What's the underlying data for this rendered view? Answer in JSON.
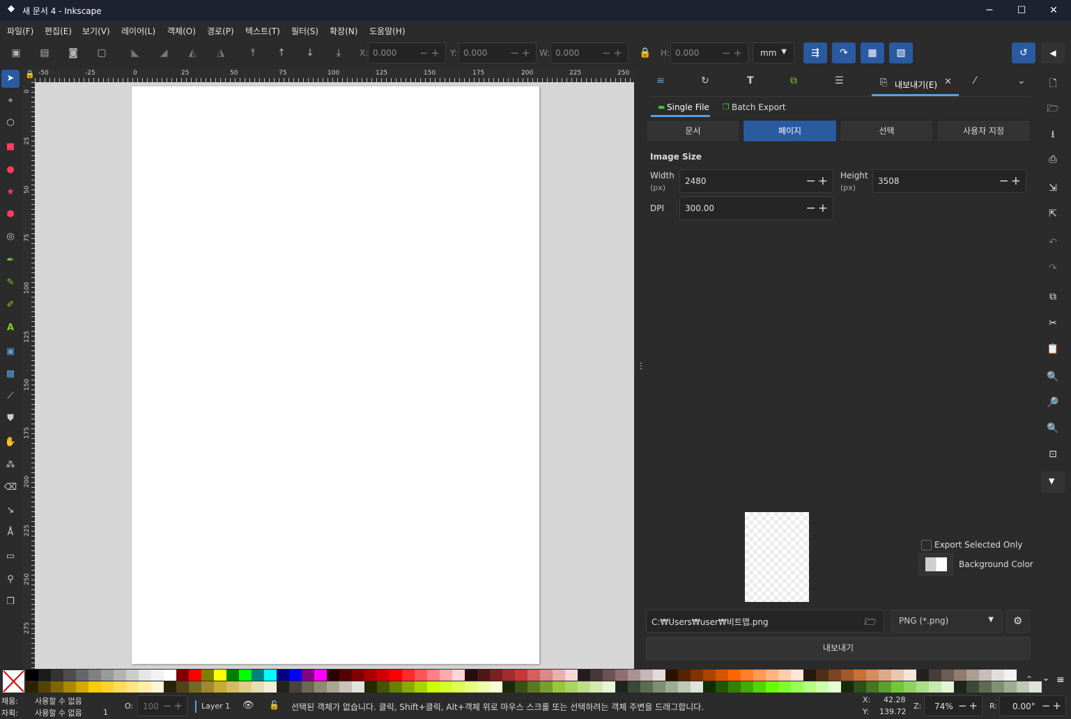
{
  "window": {
    "title": "새 문서 4 - Inkscape",
    "min": "─",
    "max": "☐",
    "close": "✕"
  },
  "menu": [
    "파일(F)",
    "편집(E)",
    "보기(V)",
    "레이어(L)",
    "객체(O)",
    "경로(P)",
    "텍스트(T)",
    "필터(S)",
    "확장(N)",
    "도움말(H)"
  ],
  "toolbar": {
    "x_label": "X:",
    "x_value": "0.000",
    "y_label": "Y:",
    "y_value": "0.000",
    "w_label": "W:",
    "w_value": "0.000",
    "h_label": "H:",
    "h_value": "0.000",
    "unit": "mm"
  },
  "ruler_top": [
    "-50",
    "-25",
    "0",
    "25",
    "50",
    "75",
    "100",
    "125",
    "150",
    "175",
    "200",
    "225",
    "250"
  ],
  "ruler_left": [
    "0",
    "25",
    "50",
    "75",
    "100",
    "125",
    "150",
    "175",
    "200",
    "225",
    "250",
    "275"
  ],
  "dock": {
    "tabs": {
      "export_label": "내보내기(E)"
    },
    "subtabs": {
      "single": "Single File",
      "batch": "Batch Export"
    },
    "areas": [
      "문서",
      "페이지",
      "선택",
      "사용자 지정"
    ],
    "active_area": "페이지",
    "image_size_label": "Image Size",
    "width_label": "Width",
    "width_unit": "(px)",
    "width_value": "2480",
    "height_label": "Height",
    "height_unit": "(px)",
    "height_value": "3508",
    "dpi_label": "DPI",
    "dpi_value": "300.00",
    "export_selected_only": "Export Selected Only",
    "background_color": "Background Color",
    "filename": "C:₩Users₩user₩비트맵.png",
    "format": "PNG (*.png)",
    "export_button": "내보내기"
  },
  "palette_colors": [
    "#000000",
    "#1a1a1a",
    "#333333",
    "#4d4d4d",
    "#666666",
    "#808080",
    "#999999",
    "#b3b3b3",
    "#cccccc",
    "#e6e6e6",
    "#f2f2f2",
    "#ffffff",
    "#800000",
    "#ff0000",
    "#808000",
    "#ffff00",
    "#008000",
    "#00ff00",
    "#008080",
    "#00ffff",
    "#000080",
    "#0000ff",
    "#800080",
    "#ff00ff",
    "#2b0000",
    "#550000",
    "#800000",
    "#aa0000",
    "#d40000",
    "#ff0000",
    "#ff2a2a",
    "#ff5555",
    "#ff8080",
    "#ffaaaa",
    "#ffd5d5",
    "#280b0b",
    "#501616",
    "#782121",
    "#a02c2c",
    "#c83737",
    "#d35f5f",
    "#de8787",
    "#e9afaf",
    "#f4d7d7",
    "#241c1c",
    "#483737",
    "#6c5353",
    "#916f6f",
    "#ac9393",
    "#c8b7b7",
    "#e3dbdb",
    "#2b1100",
    "#552200",
    "#803300",
    "#aa4400",
    "#d45500",
    "#ff6600",
    "#ff7f2a",
    "#ff9955",
    "#ffb380",
    "#ffccaa",
    "#ffe6d5",
    "#28170b",
    "#502d16",
    "#784421",
    "#a05a2c",
    "#c87137",
    "#d38d5f",
    "#deaa87",
    "#e9c6af",
    "#f4e3d7",
    "#241f1c",
    "#483e37",
    "#6c5d53",
    "#917c6f",
    "#ac9d93",
    "#c8beb7",
    "#e3dedb",
    "#f2f2f2"
  ],
  "palette_colors_row2": [
    "#2b2200",
    "#554400",
    "#806600",
    "#aa8800",
    "#d4aa00",
    "#ffcc00",
    "#ffd42a",
    "#ffdd55",
    "#ffe680",
    "#ffeeaa",
    "#fff6d5",
    "#28220b",
    "#504416",
    "#786721",
    "#a0892c",
    "#c8ab37",
    "#d3bc5f",
    "#decd87",
    "#e9ddaf",
    "#f4eed7",
    "#24221c",
    "#484537",
    "#6c6753",
    "#918a6f",
    "#aca793",
    "#c8c4b7",
    "#e3e2db",
    "#222b00",
    "#445500",
    "#668000",
    "#88aa00",
    "#aad400",
    "#ccff00",
    "#d4ff2a",
    "#ddff55",
    "#e5ff80",
    "#eeffaa",
    "#f6ffd5",
    "#1e280b",
    "#3c5016",
    "#5a7821",
    "#789f2c",
    "#96c837",
    "#abd35f",
    "#c0de87",
    "#d5e9af",
    "#eaf4d7",
    "#1f241c",
    "#3e4837",
    "#5d6c53",
    "#7c916f",
    "#9dac93",
    "#bec8b7",
    "#dee3db",
    "#112b00",
    "#225500",
    "#338000",
    "#44aa00",
    "#55d400",
    "#66ff00",
    "#7fff2a",
    "#99ff55",
    "#b3ff80",
    "#ccffaa",
    "#e5ffd5",
    "#17280b",
    "#2d5016",
    "#447821",
    "#5aa02c",
    "#71c837",
    "#8dd35f",
    "#aade87",
    "#c6e9af",
    "#e3f4d7",
    "#1f241c",
    "#3e4837",
    "#5d6c53",
    "#7c916f",
    "#9dac93",
    "#bec8b7",
    "#dee3db"
  ],
  "status": {
    "fill_label": "채움:",
    "fill_value": "사용할 수 없음",
    "stroke_label": "자획:",
    "stroke_value": "사용할 수 없음",
    "stroke_width": "1",
    "opacity_label": "O:",
    "opacity_value": "100",
    "layer": "Layer 1",
    "message": "선택된 객체가 없습니다. 클릭, Shift+클릭, Alt+객체 위로 마우스 스크롤 또는 선택하려는 객체 주변을 드래그합니다.",
    "x_label": "X:",
    "x_value": "42.28",
    "y_label": "Y:",
    "y_value": "139.72",
    "zoom_label": "Z:",
    "zoom_value": "74%",
    "rotate_label": "R:",
    "rotate_value": "0.00°"
  }
}
